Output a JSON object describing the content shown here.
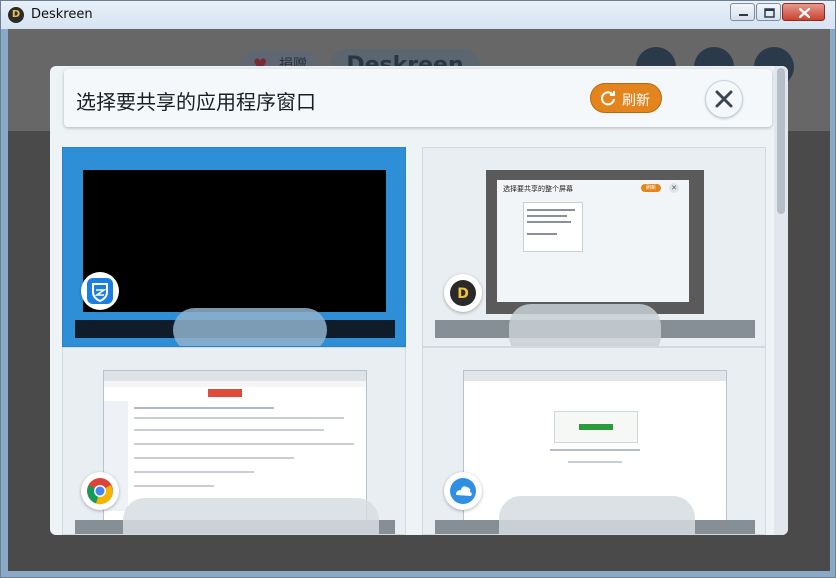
{
  "window": {
    "title": "Deskreen",
    "app_logo_letter": "D"
  },
  "background_app": {
    "donate_label": "捐赠",
    "logo_text": "Deskreen"
  },
  "dialog": {
    "title": "选择要共享的应用程序窗口",
    "refresh_label": "刷新",
    "close_icon": "close-icon"
  },
  "windows": [
    {
      "icon": "tencent-pc-manager-icon",
      "selected": true
    },
    {
      "icon": "deskreen-icon",
      "selected": false,
      "preview_title": "选择要共享的整个屏幕",
      "preview_button": "刷新"
    },
    {
      "icon": "chrome-icon",
      "selected": false
    },
    {
      "icon": "browser-cloud-icon",
      "selected": false
    }
  ],
  "colors": {
    "accent_orange": "#e3851c",
    "selected_blue": "#2f8fd6"
  }
}
